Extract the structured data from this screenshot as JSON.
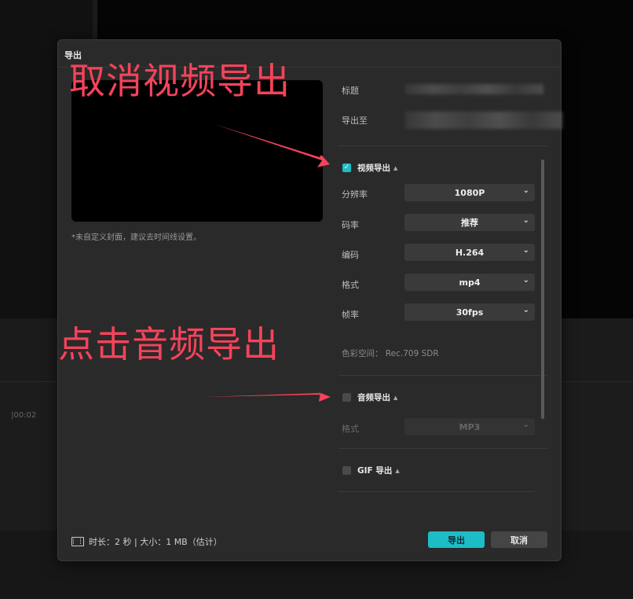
{
  "background": {
    "timeline_time": "|00:02"
  },
  "dialog": {
    "title": "导出",
    "cover_note": "*未自定义封面，建议去时间线设置。",
    "fields": {
      "title_label": "标题",
      "export_to_label": "导出至"
    },
    "video": {
      "label": "视频导出",
      "checked": true,
      "resolution": {
        "label": "分辨率",
        "value": "1080P"
      },
      "bitrate": {
        "label": "码率",
        "value": "推荐"
      },
      "codec": {
        "label": "编码",
        "value": "H.264"
      },
      "format": {
        "label": "格式",
        "value": "mp4"
      },
      "framerate": {
        "label": "帧率",
        "value": "30fps"
      },
      "color_space": "色彩空间： Rec.709 SDR"
    },
    "audio": {
      "label": "音频导出",
      "checked": false,
      "format": {
        "label": "格式",
        "value": "MP3"
      }
    },
    "gif": {
      "label": "GIF 导出",
      "checked": false
    },
    "footer": {
      "info": "时长：2 秒 | 大小：1 MB（估计）",
      "export_button": "导出",
      "cancel_button": "取消"
    }
  },
  "annotations": {
    "top": "取消视频导出",
    "middle": "点击音频导出"
  },
  "colors": {
    "accent": "#1dbdc8",
    "annotation": "#f5435a"
  }
}
